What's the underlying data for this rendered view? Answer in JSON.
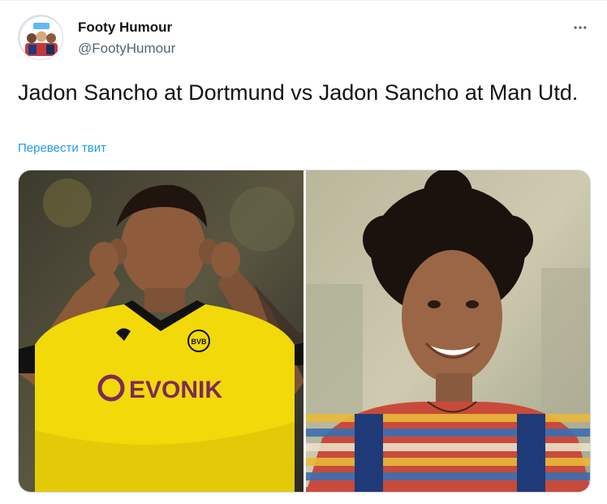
{
  "author": {
    "display_name": "Footy Humour",
    "handle": "@FootyHumour"
  },
  "tweet": {
    "text": "Jadon Sancho at Dortmund vs Jadon Sancho at Man Utd.",
    "translate_link": "Перевести твит"
  },
  "media": {
    "left_photo": {
      "shirt_sponsor": "EVONIK",
      "badge": "BVB"
    },
    "right_photo": {}
  },
  "colors": {
    "link": "#1d9bf0",
    "text": "#0f1419",
    "secondary": "#536471"
  },
  "icons": {
    "more": "more-horizontal-icon"
  }
}
